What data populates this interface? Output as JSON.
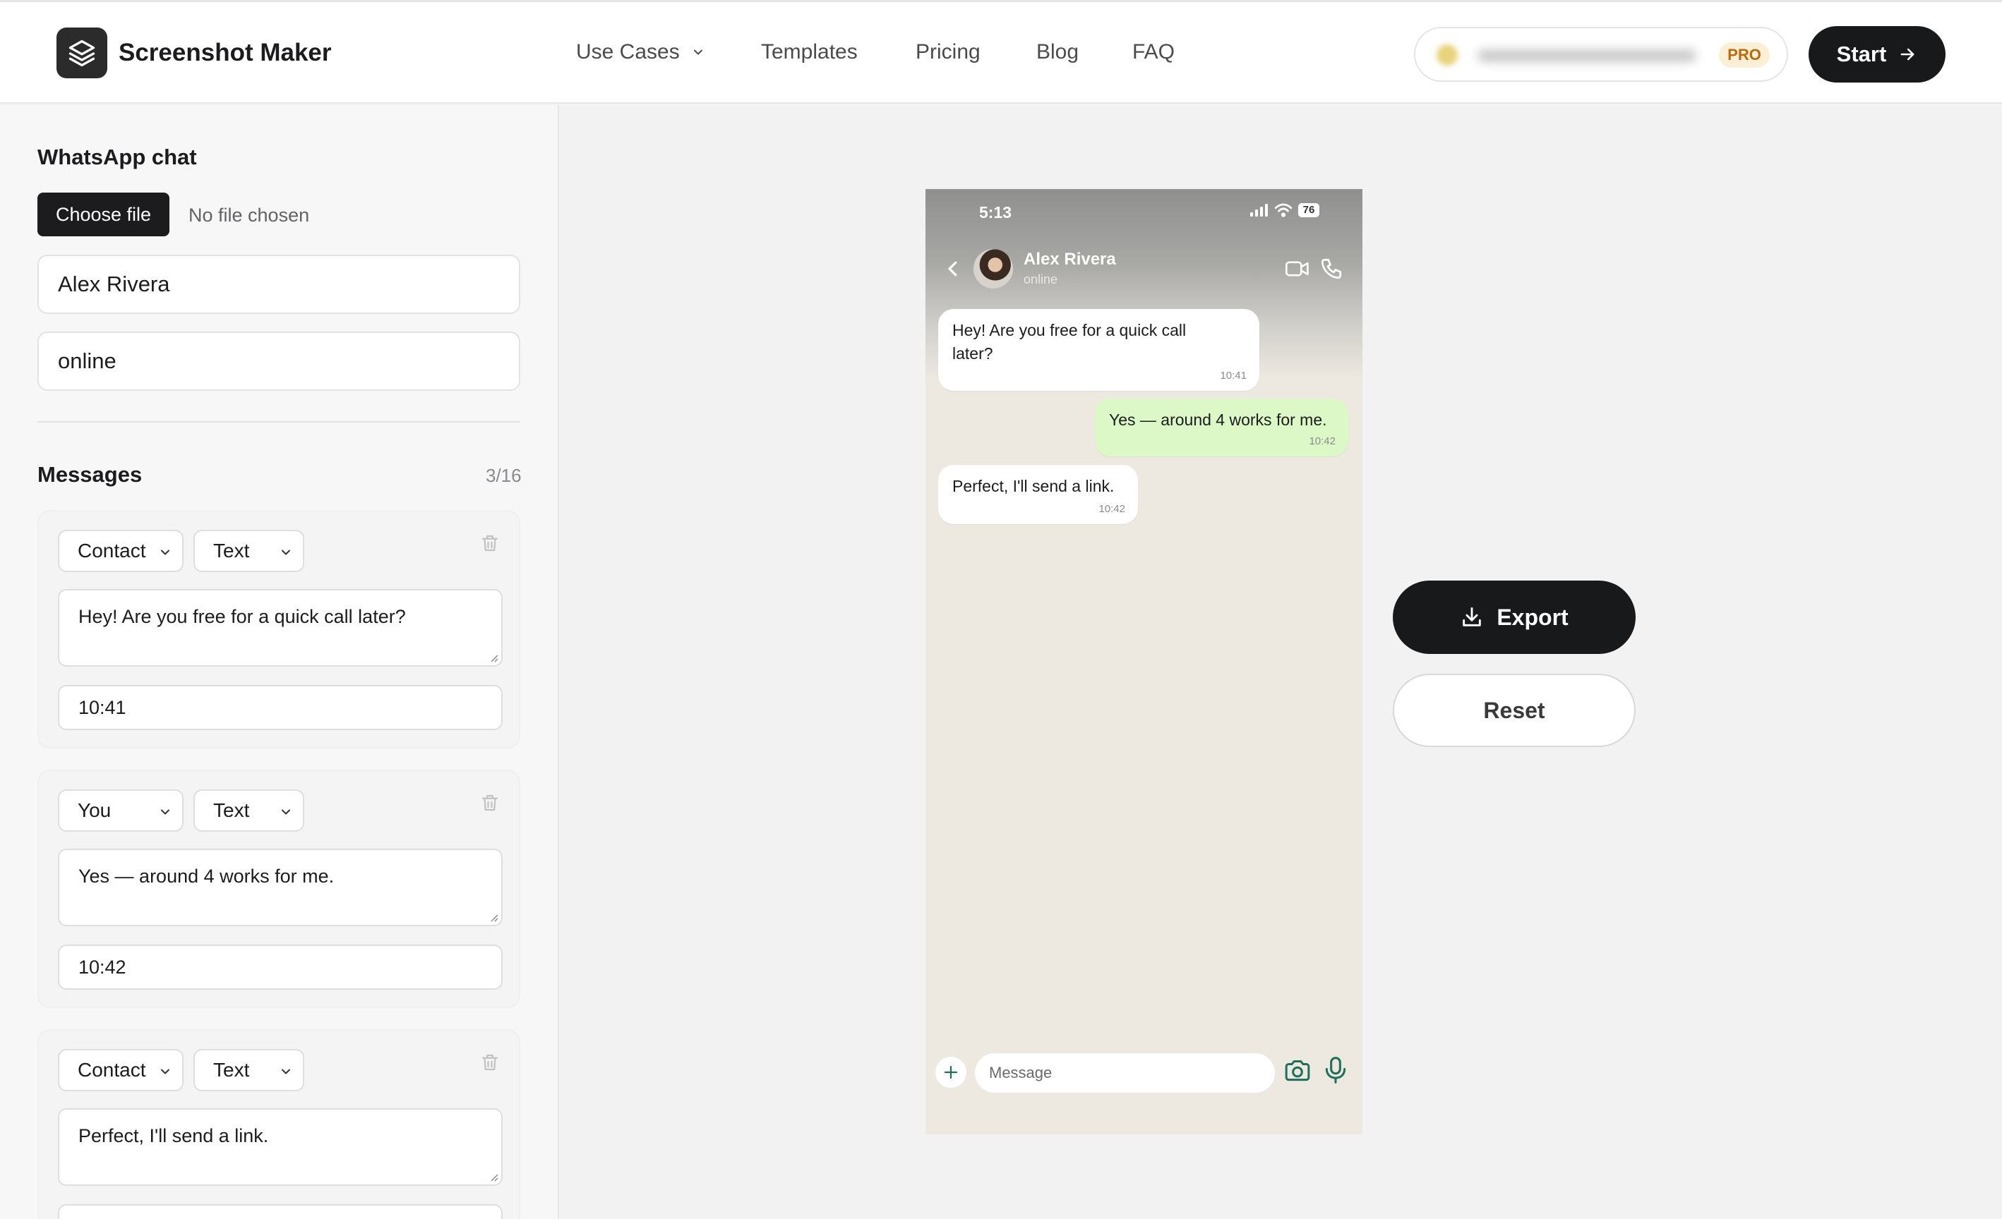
{
  "nav": {
    "brand": "Screenshot Maker",
    "use_cases": "Use Cases",
    "templates": "Templates",
    "pricing": "Pricing",
    "blog": "Blog",
    "faq": "FAQ",
    "pro_badge": "PRO",
    "start": "Start"
  },
  "sidebar": {
    "section_title": "WhatsApp chat",
    "choose_file": "Choose file",
    "no_file": "No file chosen",
    "contact_name": "Alex Rivera",
    "contact_status": "online",
    "messages_title": "Messages",
    "messages_count": "3/16",
    "messages": [
      {
        "sender": "Contact",
        "type": "Text",
        "text": "Hey! Are you free for a quick call later?",
        "time": "10:41"
      },
      {
        "sender": "You",
        "type": "Text",
        "text": "Yes — around 4 works for me.",
        "time": "10:42"
      },
      {
        "sender": "Contact",
        "type": "Text",
        "text": "Perfect, I'll send a link.",
        "time": ""
      }
    ]
  },
  "preview": {
    "status_time": "5:13",
    "battery": "76",
    "contact_name": "Alex Rivera",
    "contact_status": "online",
    "bubbles": [
      {
        "from": "contact",
        "line1": "Hey! Are you free for a quick call",
        "line2": "later?",
        "time": "10:41"
      },
      {
        "from": "me",
        "text": "Yes — around 4 works for me.",
        "time": "10:42"
      },
      {
        "from": "contact",
        "text": "Perfect, I'll send a link.",
        "time": "10:42"
      }
    ],
    "input_placeholder": "Message"
  },
  "actions": {
    "export": "Export",
    "reset": "Reset"
  },
  "colors": {
    "dark": "#18191b",
    "outgoing_bubble": "#dcf8c6",
    "chat_bg": "#ede9e1",
    "icon_green": "#1f6e5a",
    "pro_text": "#b96a0a"
  }
}
